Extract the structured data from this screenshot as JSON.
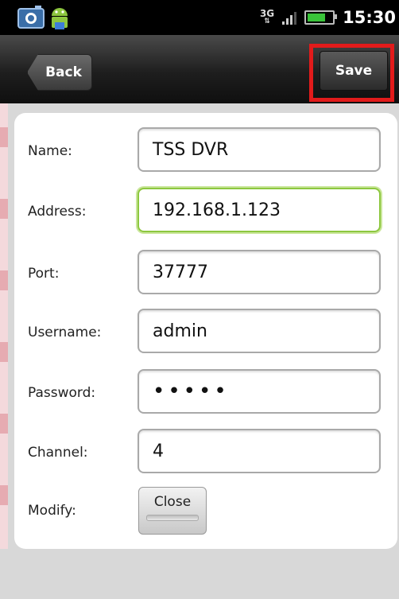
{
  "status_bar": {
    "network": "3G",
    "clock": "15:30",
    "battery_level": 0.85,
    "left_icons": [
      "camera-icon",
      "android-icon"
    ]
  },
  "title_bar": {
    "back_label": "Back",
    "save_label": "Save"
  },
  "form": {
    "name_label": "Name:",
    "name_value": "TSS DVR",
    "address_label": "Address:",
    "address_value": "192.168.1.123",
    "port_label": "Port:",
    "port_value": "37777",
    "username_label": "Username:",
    "username_value": "admin",
    "password_label": "Password:",
    "password_value": "•••••",
    "channel_label": "Channel:",
    "channel_value": "4",
    "modify_label": "Modify:",
    "close_label": "Close"
  },
  "colors": {
    "highlight_border": "#e21b1b",
    "focus_border": "#8dc73f",
    "battery_fill": "#39c439"
  }
}
